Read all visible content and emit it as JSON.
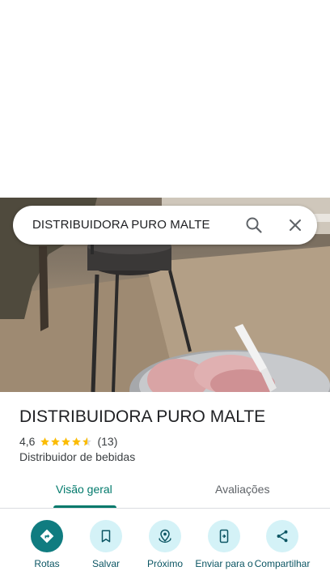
{
  "search": {
    "query": "DISTRIBUIDORA PURO MALTE"
  },
  "place": {
    "name": "DISTRIBUIDORA PURO MALTE",
    "rating": "4,6",
    "rating_value": 4.6,
    "review_count": "(13)",
    "category": "Distribuidor de bebidas"
  },
  "tabs": [
    {
      "label": "Visão geral",
      "active": true
    },
    {
      "label": "Avaliações",
      "active": false
    }
  ],
  "actions": [
    {
      "label": "Rotas",
      "icon": "directions-icon"
    },
    {
      "label": "Salvar",
      "icon": "bookmark-icon"
    },
    {
      "label": "Próximo",
      "icon": "nearby-icon"
    },
    {
      "label": "Enviar para o",
      "icon": "send-to-phone-icon"
    },
    {
      "label": "Compartilhar",
      "icon": "share-icon"
    }
  ],
  "colors": {
    "accent": "#00796b",
    "primary_action": "#107c80",
    "action_bg": "#d4f2f7",
    "star": "#fbbc04"
  }
}
